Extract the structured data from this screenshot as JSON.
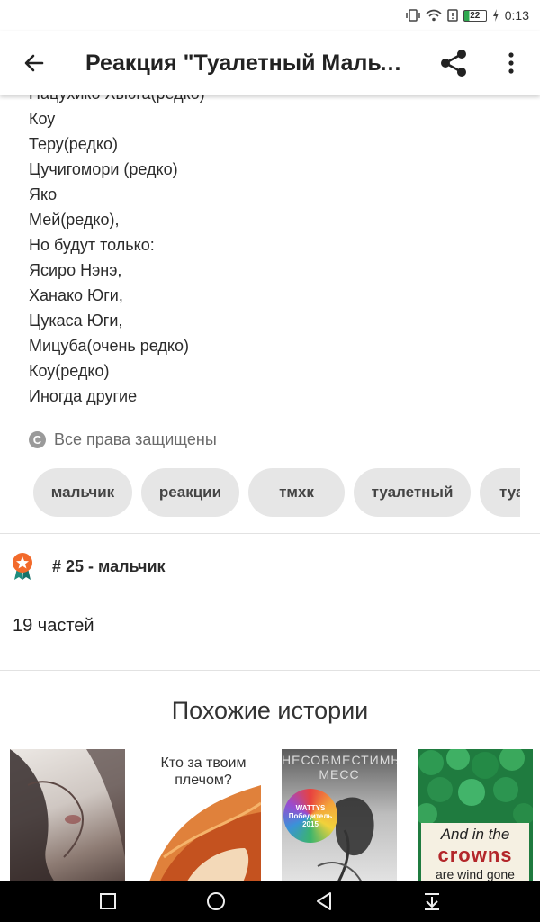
{
  "status_bar": {
    "time": "0:13",
    "battery_level": "22"
  },
  "app_bar": {
    "title": "Реакция \"Туалетный Мальчик Ханако-кун\""
  },
  "story": {
    "lines": [
      "Нацухико Хьюга(редко)",
      "Коу",
      "Теру(редко)",
      "Цучигомори (редко)",
      "Яко",
      "Мей(редко),",
      "Но будут только:",
      "Ясиро Нэнэ,",
      "Ханако Юги,",
      "Цукаса Юги,",
      "Мицуба(очень редко)",
      "Коу(редко)",
      "Иногда другие"
    ]
  },
  "copyright": {
    "icon": "copyright-icon",
    "label": "Все права защищены"
  },
  "tags": [
    "мальчик",
    "реакции",
    "тмхк",
    "туалетный",
    "туа"
  ],
  "rank": {
    "icon": "rank-badge-icon",
    "text": "# 25 - мальчик"
  },
  "parts": {
    "label": "19 частей"
  },
  "similar": {
    "title": "Похожие истории",
    "covers": [
      {
        "text": ""
      },
      {
        "text": "Кто за твоим плечом?"
      },
      {
        "text": "НЕСОВМЕСТИМЫЕ МЕСС",
        "badge_line1": "WATTYS",
        "badge_line2": "Победитель",
        "badge_line3": "2015"
      },
      {
        "line1": "And in the",
        "line2": "crowns",
        "line3": "are wind gone"
      }
    ]
  },
  "colors": {
    "accent_green": "#1f7b3f",
    "badge_orange": "#f26a2b",
    "tag_bg": "#e6e6e6"
  }
}
